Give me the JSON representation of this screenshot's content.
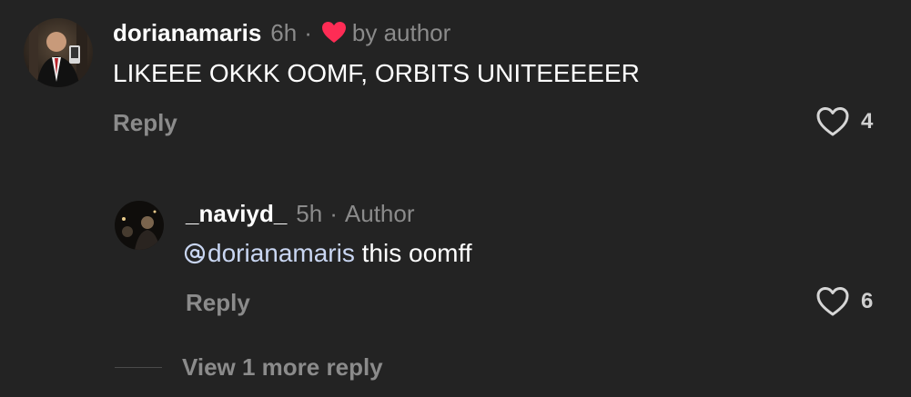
{
  "comment": {
    "username": "dorianamaris",
    "time": "6h",
    "separator": "·",
    "liked_by_label": "by author",
    "text": "LIKEEE OKKK OOMF, ORBITS UNITEEEEER",
    "reply_label": "Reply",
    "like_count": "4",
    "avatar_icon": "avatar-photo",
    "liked_by_author_icon": "red-heart-icon"
  },
  "reply": {
    "username": "_naviyd_",
    "time": "5h",
    "separator": "·",
    "author_tag": "Author",
    "mention": "dorianamaris",
    "text": " this oomff",
    "reply_label": "Reply",
    "like_count": "6",
    "avatar_icon": "avatar-photo",
    "mention_icon": "threads-at-icon"
  },
  "view_more": {
    "label": "View 1 more reply"
  },
  "colors": {
    "background": "#232323",
    "muted_text": "#8b8b8b",
    "mention": "#c9d6f2",
    "heart_red": "#fe2c55"
  }
}
